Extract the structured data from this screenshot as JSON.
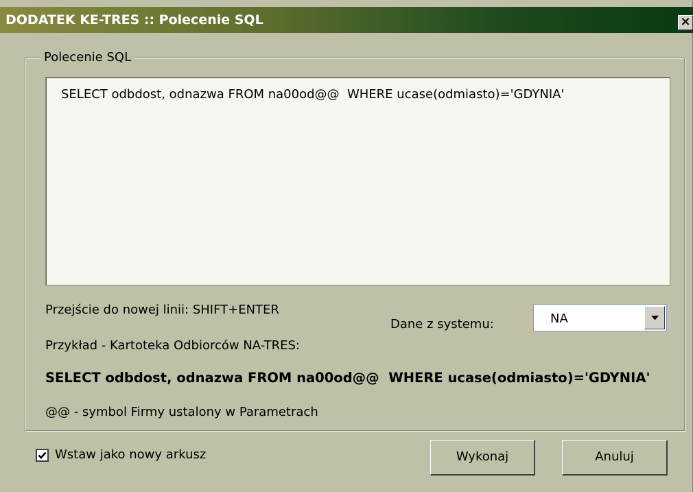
{
  "window": {
    "title": "DODATEK KE-TRES :: Polecenie SQL",
    "close_label": "×"
  },
  "group": {
    "legend": "Polecenie SQL"
  },
  "sql": {
    "value": "SELECT odbdost, odnazwa FROM na00od@@  WHERE ucase(odmiasto)='GDYNIA'"
  },
  "hints": {
    "newline": "Przejście do nowej linii: SHIFT+ENTER",
    "example_title": "Przykład - Kartoteka Odbiorców NA-TRES:",
    "example_sql": "SELECT odbdost, odnazwa FROM na00od@@  WHERE ucase(odmiasto)='GDYNIA'",
    "symbol_note": "@@ - symbol Firmy ustalony w Parametrach"
  },
  "system": {
    "label": "Dane z systemu:",
    "selected": "NA",
    "dropdown_icon": "chevron-down-icon"
  },
  "options": {
    "new_sheet_label": "Wstaw jako nowy arkusz",
    "new_sheet_checked": true
  },
  "buttons": {
    "run_label": "Wykonaj",
    "cancel_label": "Anuluj"
  },
  "colors": {
    "dialog_bg": "#c0c0a8",
    "title_gradient_end": "#0a3a12",
    "editor_bg": "#f4f8f0"
  }
}
